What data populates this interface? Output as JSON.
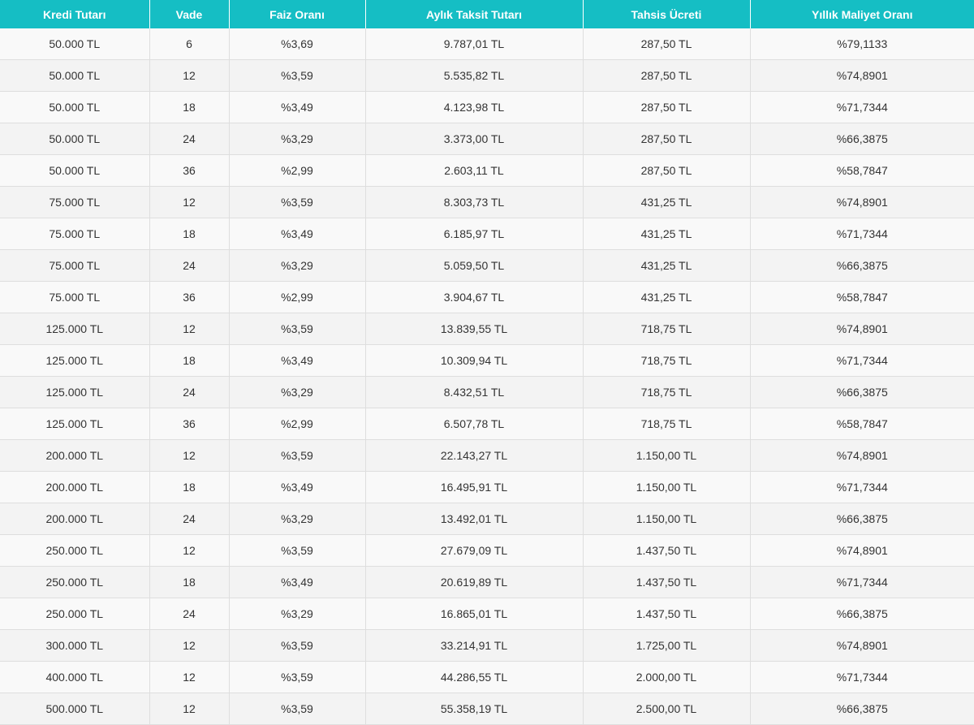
{
  "colors": {
    "header_bg": "#15bec4",
    "header_text": "#ffffff",
    "row_odd": "#f9f9f9",
    "row_even": "#f3f3f3",
    "grid_line": "#dedede",
    "cell_text": "#333333"
  },
  "table": {
    "headers": [
      "Kredi Tutarı",
      "Vade",
      "Faiz Oranı",
      "Aylık Taksit Tutarı",
      "Tahsis Ücreti",
      "Yıllık Maliyet Oranı"
    ],
    "rows": [
      [
        "50.000 TL",
        "6",
        "%3,69",
        "9.787,01 TL",
        "287,50 TL",
        "%79,1133"
      ],
      [
        "50.000 TL",
        "12",
        "%3,59",
        "5.535,82 TL",
        "287,50 TL",
        "%74,8901"
      ],
      [
        "50.000 TL",
        "18",
        "%3,49",
        "4.123,98 TL",
        "287,50 TL",
        "%71,7344"
      ],
      [
        "50.000 TL",
        "24",
        "%3,29",
        "3.373,00 TL",
        "287,50 TL",
        "%66,3875"
      ],
      [
        "50.000 TL",
        "36",
        "%2,99",
        "2.603,11 TL",
        "287,50 TL",
        "%58,7847"
      ],
      [
        "75.000 TL",
        "12",
        "%3,59",
        "8.303,73 TL",
        "431,25 TL",
        "%74,8901"
      ],
      [
        "75.000 TL",
        "18",
        "%3,49",
        "6.185,97 TL",
        "431,25 TL",
        "%71,7344"
      ],
      [
        "75.000 TL",
        "24",
        "%3,29",
        "5.059,50 TL",
        "431,25 TL",
        "%66,3875"
      ],
      [
        "75.000 TL",
        "36",
        "%2,99",
        "3.904,67 TL",
        "431,25 TL",
        "%58,7847"
      ],
      [
        "125.000 TL",
        "12",
        "%3,59",
        "13.839,55 TL",
        "718,75 TL",
        "%74,8901"
      ],
      [
        "125.000 TL",
        "18",
        "%3,49",
        "10.309,94 TL",
        "718,75 TL",
        "%71,7344"
      ],
      [
        "125.000 TL",
        "24",
        "%3,29",
        "8.432,51 TL",
        "718,75 TL",
        "%66,3875"
      ],
      [
        "125.000 TL",
        "36",
        "%2,99",
        "6.507,78 TL",
        "718,75 TL",
        "%58,7847"
      ],
      [
        "200.000 TL",
        "12",
        "%3,59",
        "22.143,27 TL",
        "1.150,00 TL",
        "%74,8901"
      ],
      [
        "200.000 TL",
        "18",
        "%3,49",
        "16.495,91 TL",
        "1.150,00 TL",
        "%71,7344"
      ],
      [
        "200.000 TL",
        "24",
        "%3,29",
        "13.492,01 TL",
        "1.150,00 TL",
        "%66,3875"
      ],
      [
        "250.000 TL",
        "12",
        "%3,59",
        "27.679,09 TL",
        "1.437,50 TL",
        "%74,8901"
      ],
      [
        "250.000 TL",
        "18",
        "%3,49",
        "20.619,89 TL",
        "1.437,50 TL",
        "%71,7344"
      ],
      [
        "250.000 TL",
        "24",
        "%3,29",
        "16.865,01 TL",
        "1.437,50 TL",
        "%66,3875"
      ],
      [
        "300.000 TL",
        "12",
        "%3,59",
        "33.214,91 TL",
        "1.725,00 TL",
        "%74,8901"
      ],
      [
        "400.000 TL",
        "12",
        "%3,59",
        "44.286,55 TL",
        "2.000,00 TL",
        "%71,7344"
      ],
      [
        "500.000 TL",
        "12",
        "%3,59",
        "55.358,19 TL",
        "2.500,00 TL",
        "%66,3875"
      ]
    ]
  }
}
